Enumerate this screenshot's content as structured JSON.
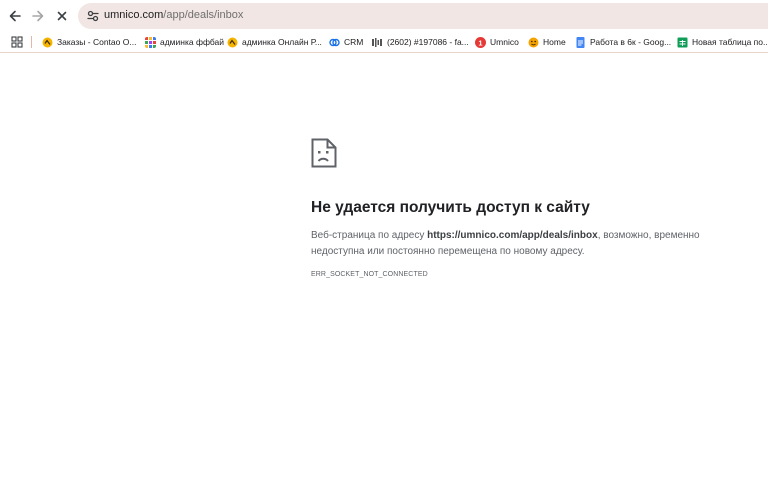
{
  "browser": {
    "url_domain": "umnico.com",
    "url_path": "/app/deals/inbox"
  },
  "icons": {
    "back": "arrow-left-icon",
    "forward": "arrow-right-icon",
    "stop": "close-icon",
    "site_info": "tune-icon",
    "apps": "apps-grid-icon",
    "error": "sad-page-icon"
  },
  "bookmarks": [
    {
      "label": "Заказы - Contao O...",
      "icon": "contao-icon",
      "color": "#f5b400"
    },
    {
      "label": "админка ффбай",
      "icon": "colorful-grid-icon",
      "color": "#e8453c"
    },
    {
      "label": "админка Онлайн Р...",
      "icon": "contao-icon",
      "color": "#f5b400"
    },
    {
      "label": "CRM",
      "icon": "crm-icon",
      "color": "#1a73e8"
    },
    {
      "label": "(2602) #197086 - fa...",
      "icon": "zendesk-icon",
      "color": "#555555"
    },
    {
      "label": "Umnico",
      "icon": "umnico-icon",
      "color": "#e53935",
      "badge": "1"
    },
    {
      "label": "Home",
      "icon": "home-emoji-icon",
      "color": "#f4a300"
    },
    {
      "label": "Работа в 6к - Goog...",
      "icon": "google-docs-icon",
      "color": "#4285f4"
    },
    {
      "label": "Новая таблица по...",
      "icon": "google-sheets-icon",
      "color": "#0f9d58"
    }
  ],
  "error": {
    "title": "Не удается получить доступ к сайту",
    "msg_prefix": "Веб-страница по адресу ",
    "msg_url": "https://umnico.com/app/deals/inbox",
    "msg_suffix": ", возможно, временно недоступна или постоянно перемещена по новому адресу.",
    "code": "ERR_SOCKET_NOT_CONNECTED"
  }
}
